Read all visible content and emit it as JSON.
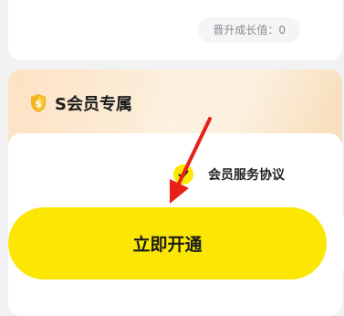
{
  "growth": {
    "label": "晋升成长值：0"
  },
  "svip": {
    "title": "S会员专属",
    "badge_icon": "shield-s-icon"
  },
  "agreement": {
    "label": "会员服务协议",
    "checked": true,
    "icon": "check-icon"
  },
  "cta": {
    "label": "立即开通"
  },
  "annotation": {
    "icon": "arrow-icon"
  },
  "colors": {
    "primary_yellow": "#fbe604",
    "svip_gradient_start": "#fde2c4",
    "svip_gradient_end": "#f7dcb7",
    "badge_gold": "#f3b422",
    "arrow_red": "#e8201a"
  }
}
